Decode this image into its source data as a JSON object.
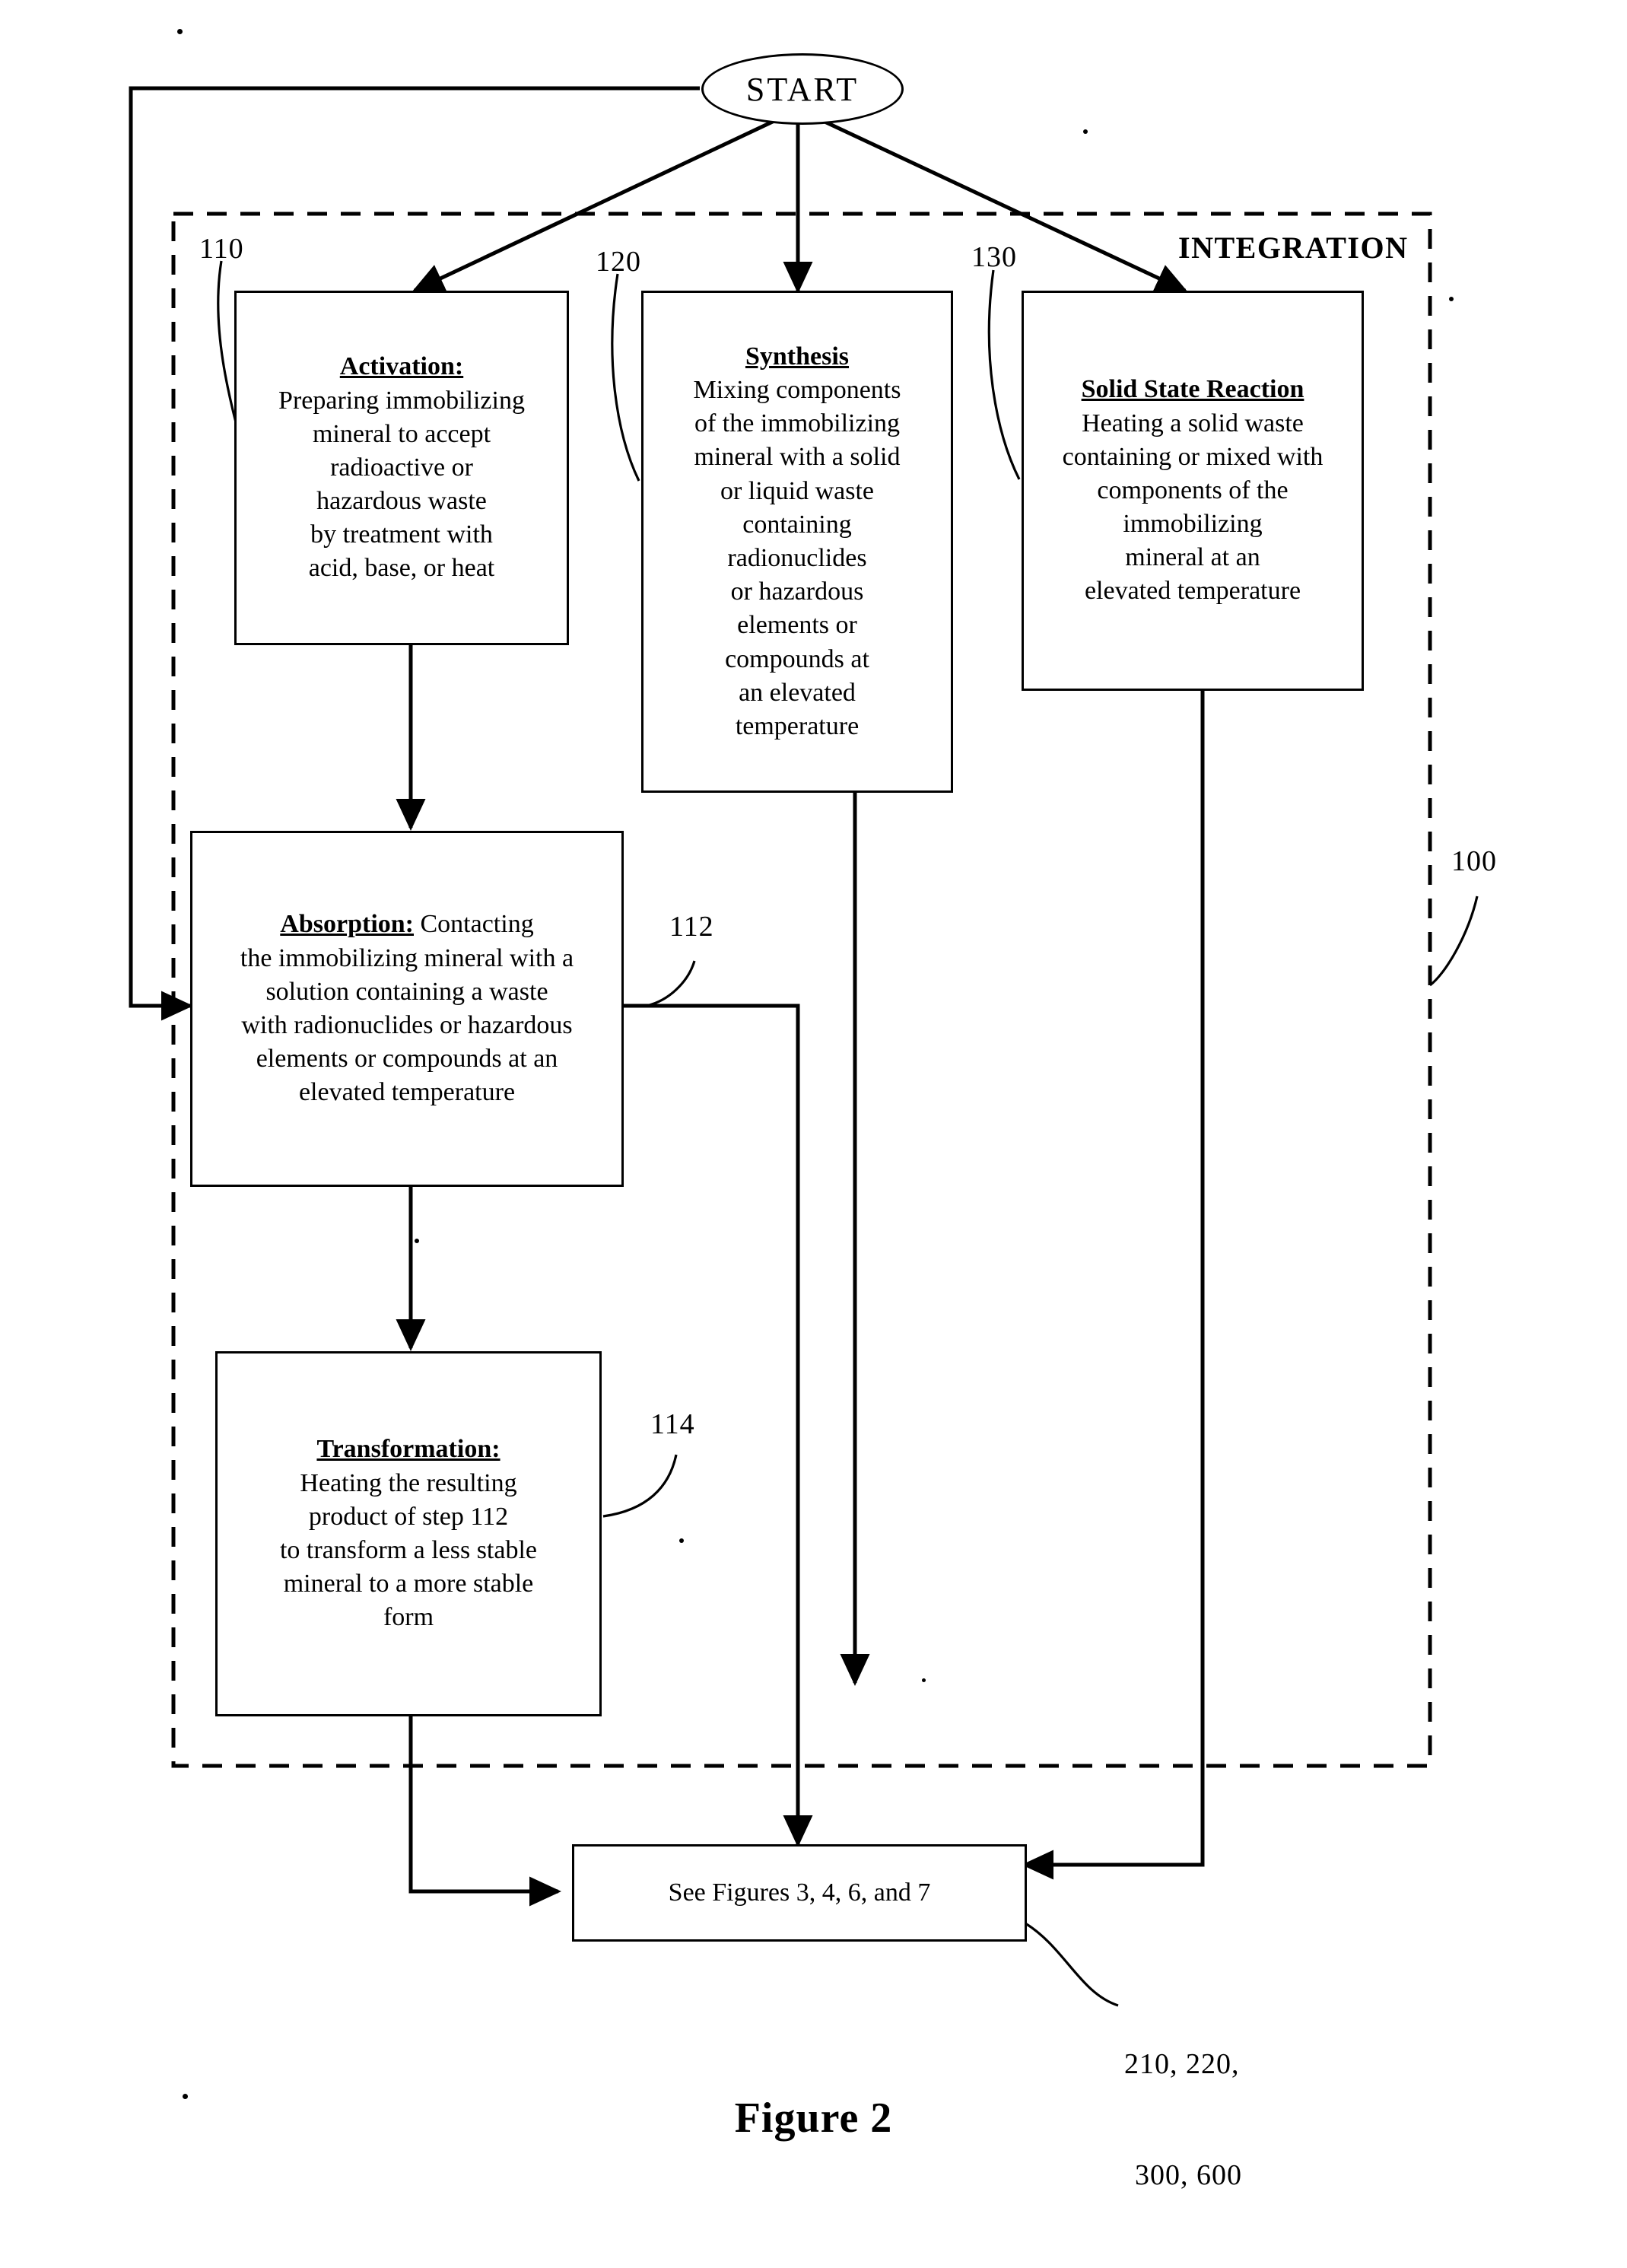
{
  "figure": {
    "caption": "Figure 2",
    "group_label": "INTEGRATION",
    "group_ref": "100"
  },
  "start": {
    "label": "START"
  },
  "nodes": [
    {
      "id": "activation",
      "ref": "110",
      "heading": "Activation:",
      "heading_underlined": true,
      "lines": [
        "Preparing immobilizing",
        "mineral to accept",
        "radioactive or",
        "hazardous waste",
        "by treatment with",
        "acid, base, or heat"
      ]
    },
    {
      "id": "synthesis",
      "ref": "120",
      "heading": "Synthesis",
      "heading_underlined": true,
      "lines": [
        "Mixing components",
        "of the immobilizing",
        "mineral with a solid",
        "or liquid waste",
        "containing",
        "radionuclides",
        "or hazardous",
        "elements or",
        "compounds at",
        "an elevated",
        "temperature"
      ]
    },
    {
      "id": "solid-state-reaction",
      "ref": "130",
      "heading": "Solid State Reaction",
      "heading_underlined": true,
      "lines": [
        "Heating a solid waste",
        "containing or mixed with",
        "components of the",
        "immobilizing",
        "mineral at an",
        "elevated temperature"
      ]
    },
    {
      "id": "absorption",
      "ref": "112",
      "heading": "Absorption:",
      "heading_underlined": true,
      "heading_inline_tail": "  Contacting",
      "lines": [
        "the immobilizing mineral with a",
        "solution containing a waste",
        "with radionuclides or hazardous",
        "elements or compounds at an",
        "elevated temperature"
      ]
    },
    {
      "id": "transformation",
      "ref": "114",
      "heading": "Transformation:",
      "heading_underlined": true,
      "lines": [
        "Heating the resulting",
        "product of step 112",
        "to  transform a less stable",
        "mineral to a more stable",
        "form"
      ]
    },
    {
      "id": "see-figures",
      "ref": "210, 220,\n300, 600",
      "heading": "",
      "lines": [
        "See Figures 3, 4, 6, and 7"
      ]
    }
  ],
  "reference_numerals": {
    "activation": "110",
    "synthesis": "120",
    "solid_state_reaction": "130",
    "absorption": "112",
    "transformation": "114",
    "integration_group": "100",
    "downstream_line1": "210, 220,",
    "downstream_line2": "300, 600"
  },
  "colors": {
    "stroke": "#000000",
    "background": "#ffffff"
  }
}
